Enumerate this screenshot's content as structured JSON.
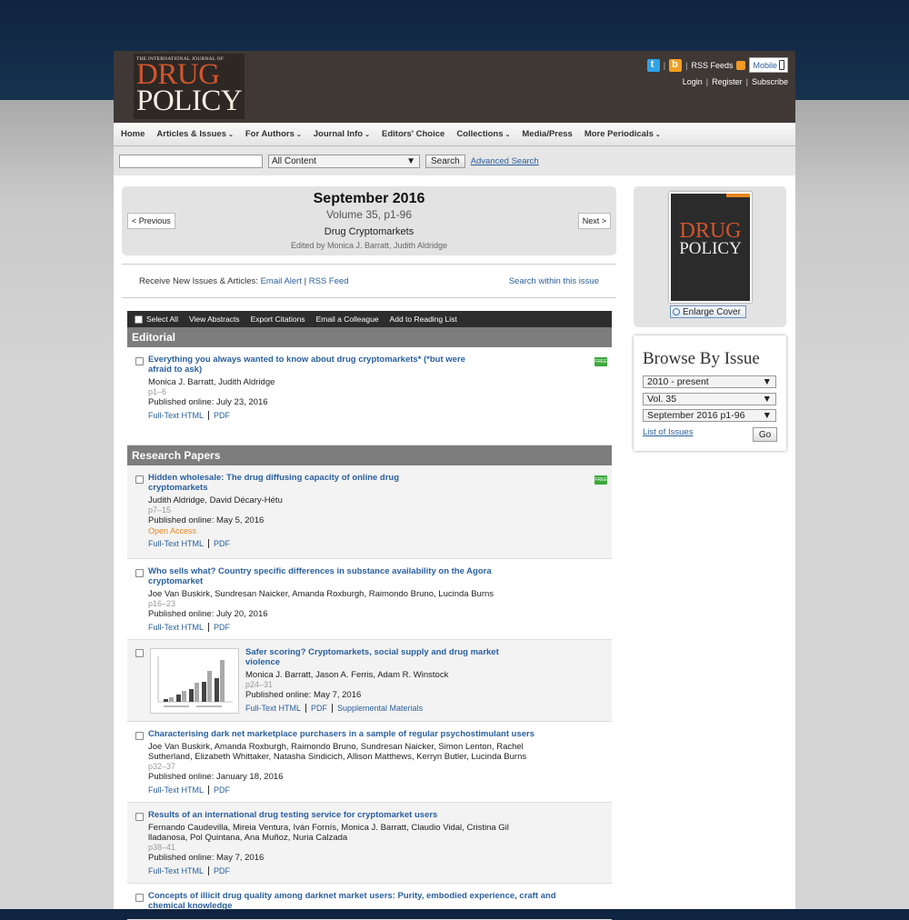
{
  "header": {
    "logo": {
      "small": "THE INTERNATIONAL JOURNAL OF",
      "line1": "DRUG",
      "line2": "POLICY"
    },
    "top_links": {
      "rss": "RSS Feeds",
      "mobile": "Mobile"
    },
    "account": {
      "login": "Login",
      "register": "Register",
      "subscribe": "Subscribe"
    }
  },
  "nav": {
    "items": [
      {
        "label": "Home",
        "dropdown": false
      },
      {
        "label": "Articles & Issues",
        "dropdown": true
      },
      {
        "label": "For Authors",
        "dropdown": true
      },
      {
        "label": "Journal Info",
        "dropdown": true
      },
      {
        "label": "Editors' Choice",
        "dropdown": false
      },
      {
        "label": "Collections",
        "dropdown": true
      },
      {
        "label": "Media/Press",
        "dropdown": false
      },
      {
        "label": "More Periodicals",
        "dropdown": true
      }
    ]
  },
  "search": {
    "query": "",
    "scope": "All Content",
    "button": "Search",
    "advanced": "Advanced Search"
  },
  "issue": {
    "title": "September 2016",
    "volume": "Volume 35, p1-96",
    "subtitle": "Drug Cryptomarkets",
    "editors": "Edited by Monica J. Barratt, Judith Aldridge",
    "prev": "< Previous",
    "next": "Next >"
  },
  "receive": {
    "label": "Receive New Issues & Articles:",
    "email_alert": "Email Alert",
    "sep": "|",
    "rss_feed": "RSS Feed",
    "search_within": "Search within this issue"
  },
  "actions": {
    "select_all": "Select All",
    "view_abstracts": "View Abstracts",
    "export": "Export Citations",
    "email": "Email a Colleague",
    "reading_list": "Add to Reading List"
  },
  "sections": {
    "editorial": "Editorial",
    "research": "Research Papers"
  },
  "links": {
    "fulltext": "Full-Text HTML",
    "pdf": "PDF",
    "supp": "Supplemental Materials"
  },
  "articles": [
    {
      "title": "Everything you always wanted to know about drug cryptomarkets* (*but were afraid to ask)",
      "authors": "Monica J. Barratt, Judith Aldridge",
      "pages": "p1–6",
      "published": "Published online: July 23, 2016"
    },
    {
      "title": "Hidden wholesale: The drug diffusing capacity of online drug cryptomarkets",
      "authors": "Judith Aldridge, David Décary-Hétu",
      "pages": "p7–15",
      "published": "Published online: May 5, 2016",
      "open_access": "Open Access"
    },
    {
      "title": "Who sells what? Country specific differences in substance availability on the Agora cryptomarket",
      "authors": "Joe Van Buskirk, Sundresan Naicker, Amanda Roxburgh, Raimondo Bruno, Lucinda Burns",
      "pages": "p16–23",
      "published": "Published online: July 20, 2016"
    },
    {
      "title": "Safer scoring? Cryptomarkets, social supply and drug market violence",
      "authors": "Monica J. Barratt, Jason A. Ferris, Adam R. Winstock",
      "pages": "p24–31",
      "published": "Published online: May 7, 2016"
    },
    {
      "title": "Characterising dark net marketplace purchasers in a sample of regular psychostimulant users",
      "authors": "Joe Van Buskirk, Amanda Roxburgh, Raimondo Bruno, Sundresan Naicker, Simon Lenton, Rachel Sutherland, Elizabeth Whittaker, Natasha Sindicich, Allison Matthews, Kerryn Butler, Lucinda Burns",
      "pages": "p32–37",
      "published": "Published online: January 18, 2016"
    },
    {
      "title": "Results of an international drug testing service for cryptomarket users",
      "authors": "Fernando Caudevilla, Mireia Ventura, Iván Fornís, Monica J. Barratt, Claudio Vidal, Cristina Gil lladanosa, Pol Quintana, Ana Muñoz, Nuria Calzada",
      "pages": "p38–41",
      "published": "Published online: May 7, 2016"
    },
    {
      "title": "Concepts of illicit drug quality among darknet market users: Purity, embodied experience, craft and chemical knowledge"
    }
  ],
  "sidebar": {
    "cover": {
      "line1": "DRUG",
      "line2": "POLICY"
    },
    "enlarge": "Enlarge Cover",
    "browse_title": "Browse By Issue",
    "years": "2010 - present",
    "volume": "Vol. 35",
    "issue": "September 2016 p1-96",
    "list": "List of Issues",
    "go": "Go"
  },
  "icons": [
    "twitter-icon",
    "blogger-icon",
    "rss-icon",
    "phone-icon",
    "free-icon",
    "magnifier-icon"
  ]
}
